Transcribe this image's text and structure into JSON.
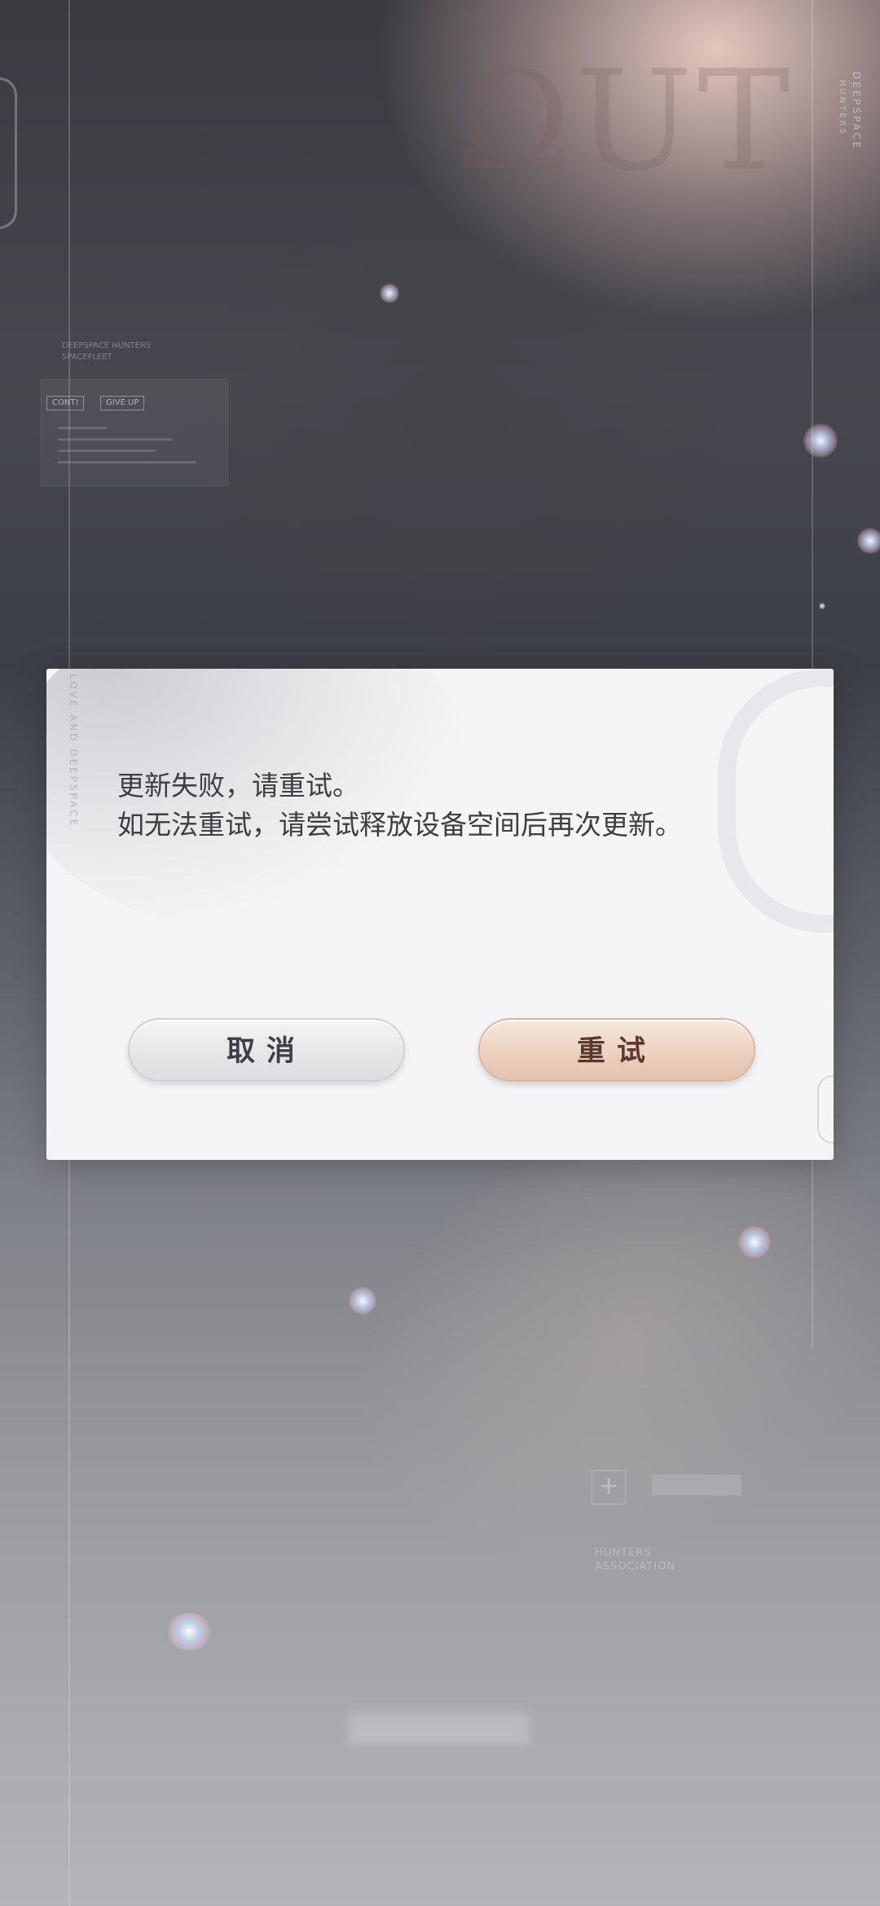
{
  "background": {
    "side_text_top": "DEEPSPACE",
    "side_text_sub": "HUNTERS",
    "caption_lines": [
      "DEEPSPACE HUNTERS",
      "SPACEFLEET"
    ],
    "chips": [
      "CONT!",
      "GIVE UP"
    ],
    "bottom_title_lines": [
      "HUNTERS",
      "ASSOCIATION"
    ]
  },
  "dialog": {
    "side_text": "LOVE AND DEEPSPACE",
    "message_line1": "更新失败，请重试。",
    "message_line2": "如无法重试，请尝试释放设备空间后再次更新。",
    "cancel_label": "取消",
    "retry_label": "重试"
  },
  "colors": {
    "dialog_bg": "#f5f5f7",
    "message_text": "#3d3d42",
    "cancel_text": "#3e3f45",
    "retry_text": "#5a3a2e",
    "retry_accent": "#ecd1bf"
  }
}
